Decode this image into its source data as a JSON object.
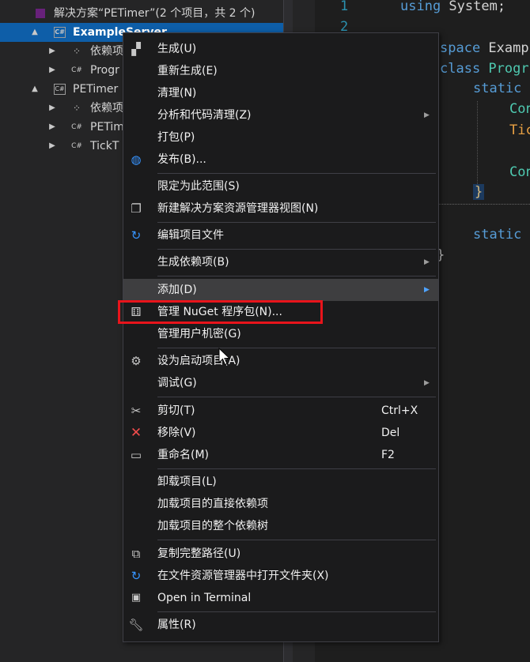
{
  "explorer": {
    "solution": "解决方案“PETimer”(2 个项目，共 2 个)",
    "rows": [
      {
        "label": "ExampleServer",
        "icon": "csharp-project-icon",
        "twisty": "▲"
      },
      {
        "label": "依赖项",
        "icon": "dependencies-icon",
        "twisty": "▶"
      },
      {
        "label": "Progr",
        "icon": "csharp-file-icon",
        "twisty": "▶"
      },
      {
        "label": "PETimer",
        "icon": "csharp-project-icon",
        "twisty": "▲"
      },
      {
        "label": "依赖项",
        "icon": "dependencies-icon",
        "twisty": "▶"
      },
      {
        "label": "PETim",
        "icon": "csharp-file-icon",
        "twisty": "▶"
      },
      {
        "label": "TickT",
        "icon": "csharp-file-icon",
        "twisty": "▶"
      }
    ]
  },
  "editor": {
    "line_numbers": [
      "1",
      "2"
    ],
    "code": {
      "l1_kw": "using",
      "l1_rest": " System;",
      "l2a": "space",
      "l2b": " Examp",
      "l3a": "class",
      "l3b": " Progr",
      "l4": "static",
      "l5": "Con",
      "l6": "Tic",
      "l7": "Con",
      "l8": "}",
      "l9": "static",
      "l10": "}"
    }
  },
  "menu": {
    "items": [
      {
        "label": "生成(U)",
        "icon": "build-icon"
      },
      {
        "label": "重新生成(E)"
      },
      {
        "label": "清理(N)"
      },
      {
        "label": "分析和代码清理(Z)",
        "submenu": true
      },
      {
        "label": "打包(P)"
      },
      {
        "label": "发布(B)...",
        "icon": "publish-globe-icon"
      },
      {
        "label": "限定为此范围(S)"
      },
      {
        "label": "新建解决方案资源管理器视图(N)",
        "icon": "new-view-icon"
      },
      {
        "label": "编辑项目文件",
        "icon": "refresh-edit-icon"
      },
      {
        "label": "生成依赖项(B)",
        "submenu": true
      },
      {
        "label": "添加(D)",
        "submenu": true,
        "highlighted": true
      },
      {
        "label": "管理 NuGet 程序包(N)...",
        "icon": "nuget-package-icon"
      },
      {
        "label": "管理用户机密(G)"
      },
      {
        "label": "设为启动项目(A)",
        "icon": "gear-icon"
      },
      {
        "label": "调试(G)",
        "submenu": true
      },
      {
        "label": "剪切(T)",
        "icon": "scissors-icon",
        "shortcut": "Ctrl+X"
      },
      {
        "label": "移除(V)",
        "icon": "remove-x-icon",
        "shortcut": "Del"
      },
      {
        "label": "重命名(M)",
        "icon": "rename-icon",
        "shortcut": "F2"
      },
      {
        "label": "卸载项目(L)"
      },
      {
        "label": "加载项目的直接依赖项"
      },
      {
        "label": "加载项目的整个依赖树"
      },
      {
        "label": "复制完整路径(U)",
        "icon": "copy-icon"
      },
      {
        "label": "在文件资源管理器中打开文件夹(X)",
        "icon": "open-folder-refresh-icon"
      },
      {
        "label": "Open in Terminal",
        "icon": "terminal-icon"
      },
      {
        "label": "属性(R)",
        "icon": "wrench-icon"
      }
    ]
  },
  "colors": {
    "selection": "#0e5ea8",
    "highlight_box": "#e8141b",
    "menu_bg": "#1b1b1c"
  }
}
